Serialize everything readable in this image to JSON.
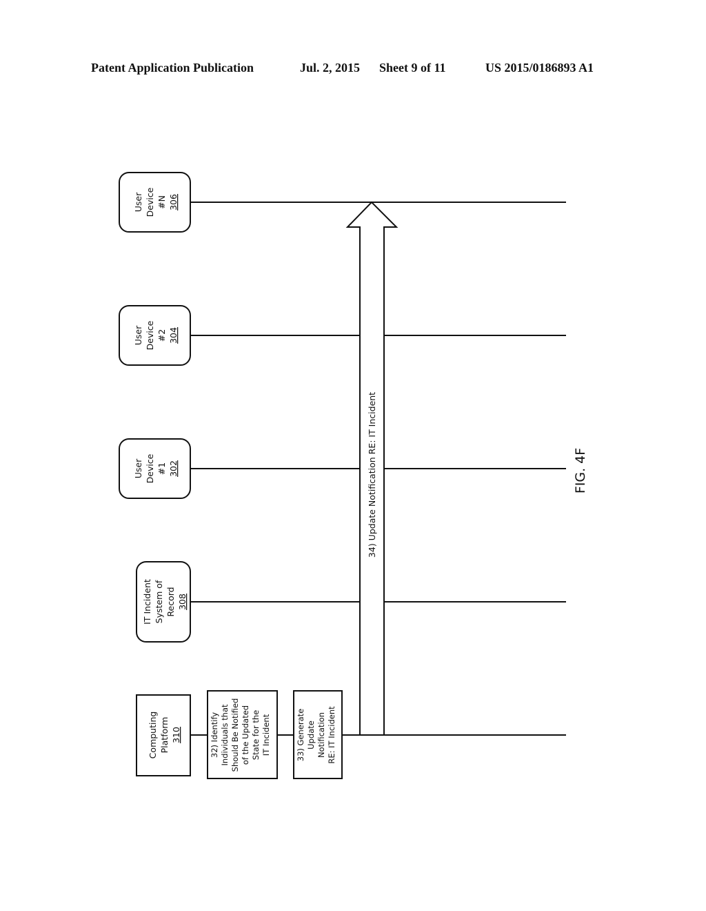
{
  "header": {
    "publication": "Patent Application Publication",
    "date": "Jul. 2, 2015",
    "sheet": "Sheet 9 of 11",
    "number": "US 2015/0186893 A1"
  },
  "figure_label": "FIG. 4F",
  "entities": [
    {
      "id": "computing-platform",
      "lines": [
        "Computing",
        "Platform"
      ],
      "ref": "310",
      "shape": "rectangle"
    },
    {
      "id": "it-incident-system",
      "lines": [
        "IT Incident",
        "System of",
        "Record"
      ],
      "ref": "308",
      "shape": "rounded"
    },
    {
      "id": "user-device-1",
      "lines": [
        "User",
        "Device",
        "#1"
      ],
      "ref": "302",
      "shape": "rounded"
    },
    {
      "id": "user-device-2",
      "lines": [
        "User",
        "Device",
        "#2"
      ],
      "ref": "304",
      "shape": "rounded"
    },
    {
      "id": "user-device-n",
      "lines": [
        "User",
        "Device",
        "#N"
      ],
      "ref": "306",
      "shape": "rounded"
    }
  ],
  "steps": [
    {
      "id": "step-32",
      "lines": [
        "32) Identify",
        "Individuals that",
        "Should Be Notified",
        "of the Updated",
        "State for the",
        "IT Incident"
      ]
    },
    {
      "id": "step-33",
      "lines": [
        "33) Generate",
        "Update",
        "Notification",
        "RE: IT Incident"
      ]
    }
  ],
  "message": {
    "label": "34) Update Notification RE: IT Incident",
    "from": "computing-platform",
    "to": "user-device-n"
  }
}
